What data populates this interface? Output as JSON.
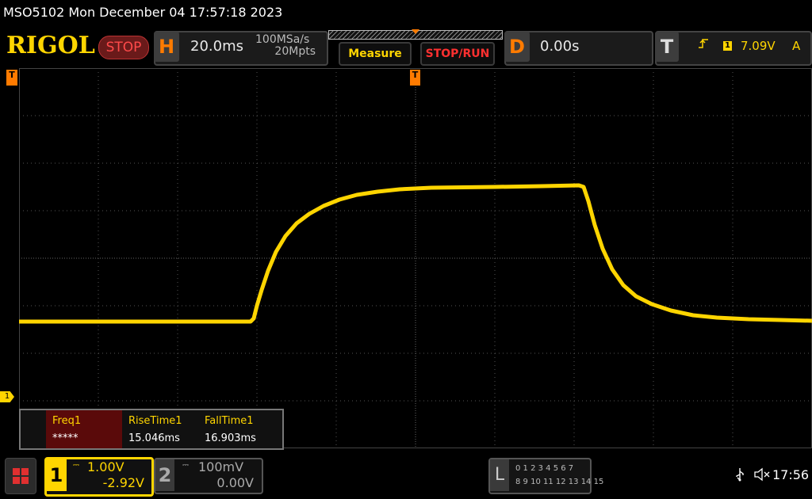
{
  "title_bar": "MSO5102  Mon December 04 17:57:18 2023",
  "logo": "RIGOL",
  "run_status": "STOP",
  "horizontal": {
    "letter": "H",
    "timebase": "20.0ms",
    "sample_rate": "100MSa/s",
    "memory_depth": "20Mpts"
  },
  "buttons": {
    "measure": "Measure",
    "stop_run": "STOP/RUN"
  },
  "delay": {
    "letter": "D",
    "value": "0.00s"
  },
  "trigger": {
    "letter": "T",
    "channel": "1",
    "level": "7.09V",
    "mode": "A"
  },
  "markers": {
    "ch1": "1",
    "trigger": "T"
  },
  "measurements": [
    {
      "name": "Freq1",
      "value": "*****"
    },
    {
      "name": "RiseTime1",
      "value": "15.046ms"
    },
    {
      "name": "FallTime1",
      "value": "16.903ms"
    }
  ],
  "channels": [
    {
      "number": "1",
      "scale": "1.00V",
      "offset": "-2.92V",
      "color": "#ffd500"
    },
    {
      "number": "2",
      "scale": "100mV",
      "offset": "0.00V",
      "color": "#aaaaaa"
    }
  ],
  "logic": {
    "letter": "L",
    "row1": "0 1 2 3   4 5 6 7",
    "row2": "8 9 10 11 12 13 14 15"
  },
  "clock": "17:56",
  "icons": [
    "menu-icon",
    "usb-icon",
    "speaker-muted-icon",
    "trigger-edge-icon"
  ],
  "colors": {
    "trace": "#ffd500",
    "accent": "#ff7b00",
    "stop": "#ff3030"
  }
}
